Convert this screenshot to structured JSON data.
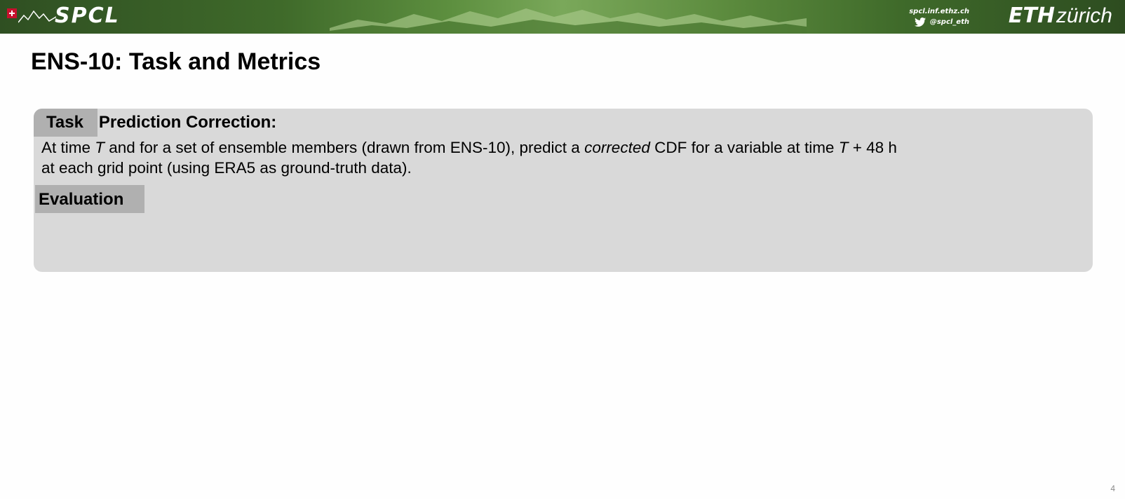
{
  "header": {
    "logo_text": "SPCL",
    "website": "spcl.inf.ethz.ch",
    "twitter_handle": "@spcl_eth",
    "eth_text": "ETH",
    "zurich_text": "zürich"
  },
  "slide": {
    "title": "ENS-10: Task and Metrics",
    "task_label": "Task",
    "task_heading": "Prediction Correction:",
    "description": {
      "part1": "At time ",
      "T1": "T",
      "part2": " and for a set of ensemble members (drawn from ENS-10), predict a ",
      "corrected": "corrected",
      "part3": " CDF for a variable at time ",
      "T2": "T",
      "part4": " + 48 h",
      "line2": "at each grid point (using ERA5 as ground-truth data)."
    },
    "evaluation_label": "Evaluation",
    "page_number": "4"
  },
  "colors": {
    "box_background": "#d9d9d9",
    "tab_background": "#b0b0b0",
    "header_green": "#3f6a2a"
  }
}
